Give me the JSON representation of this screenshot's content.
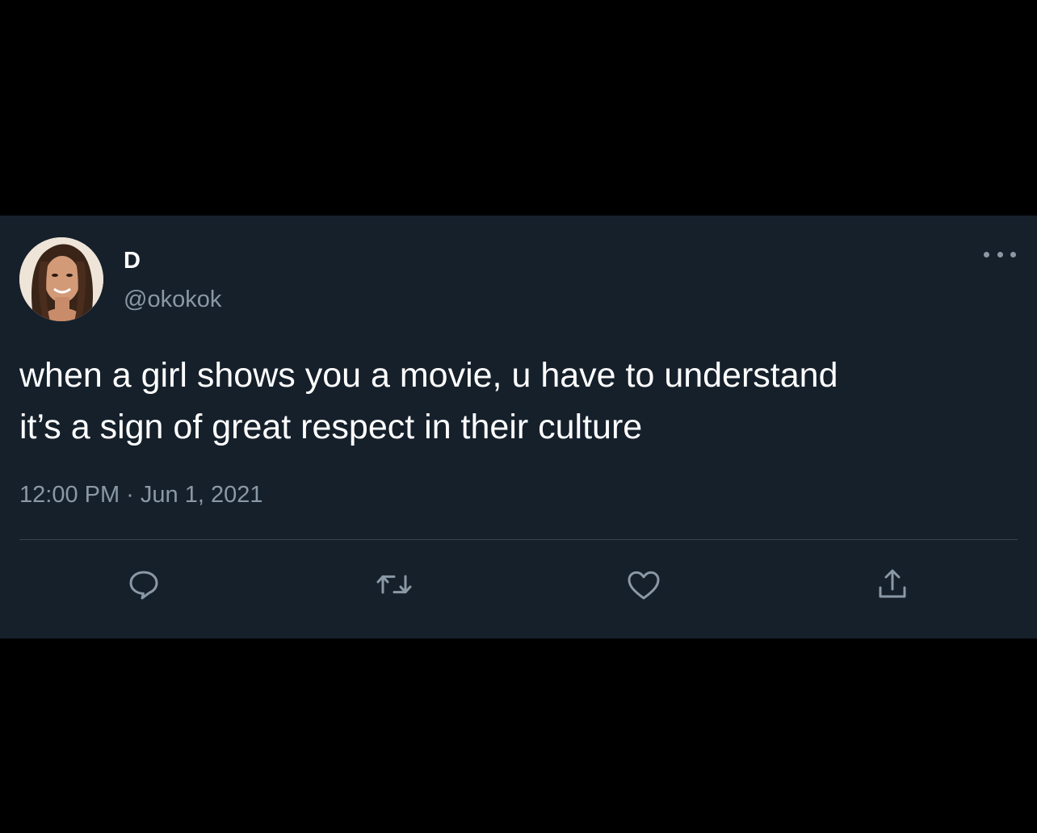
{
  "tweet": {
    "display_name": "D",
    "handle": "@okokok",
    "text": "when a girl shows you a movie, u have to understand\nit’s a sign of great respect in their culture",
    "timestamp": "12:00 PM · Jun 1, 2021"
  },
  "actions": {
    "reply_icon": "reply-icon",
    "retweet_icon": "retweet-icon",
    "like_icon": "heart-icon",
    "share_icon": "share-icon",
    "more_icon": "more-icon"
  },
  "colors": {
    "card_background": "#15202b",
    "page_background": "#000000",
    "primary_text": "#ffffff",
    "secondary_text": "#8b98a5",
    "icon": "#8b98a5",
    "divider": "#38444d"
  }
}
